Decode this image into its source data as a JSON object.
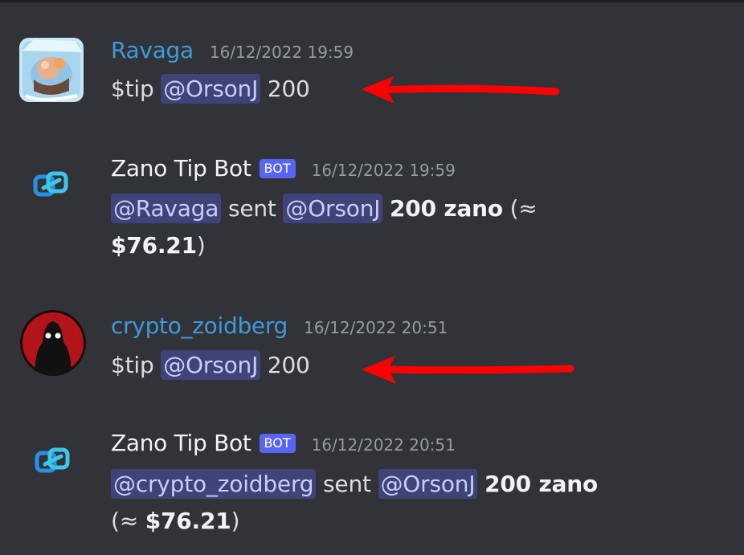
{
  "messages": [
    {
      "username": "Ravaga",
      "timestamp": "16/12/2022 19:59",
      "text_prefix": "$tip",
      "mention": "@OrsonJ",
      "text_suffix": "200",
      "avatar": "ice-cube-avatar"
    },
    {
      "username": "Zano Tip Bot",
      "bot_tag": "BOT",
      "timestamp": "16/12/2022 19:59",
      "sender_mention": "@Ravaga",
      "sent_word": "sent",
      "recipient_mention": "@OrsonJ",
      "amount": "200 zano",
      "approx_open": "(≈",
      "usd": "$76.21",
      "approx_close": ")",
      "avatar": "zano-link-icon"
    },
    {
      "username": "crypto_zoidberg",
      "timestamp": "16/12/2022 20:51",
      "text_prefix": "$tip",
      "mention": "@OrsonJ",
      "text_suffix": "200",
      "avatar": "hooded-figure-avatar"
    },
    {
      "username": "Zano Tip Bot",
      "bot_tag": "BOT",
      "timestamp": "16/12/2022 20:51",
      "sender_mention": "@crypto_zoidberg",
      "sent_word": "sent",
      "recipient_mention": "@OrsonJ",
      "amount": "200 zano",
      "approx_open": "(≈",
      "usd": "$76.21",
      "approx_close": ")",
      "avatar": "zano-link-icon"
    }
  ],
  "colors": {
    "background": "#313338",
    "username_user": "#3f99d8",
    "bot_tag": "#5865f2",
    "mention_bg": "#3f4378",
    "arrow": "#ff0000"
  },
  "annotations": [
    "red-arrow-pointer",
    "red-arrow-pointer"
  ]
}
